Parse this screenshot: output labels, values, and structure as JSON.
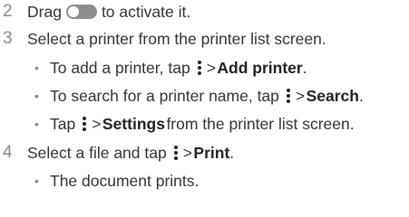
{
  "steps": [
    {
      "number": "2",
      "text_before": "Drag",
      "text_after": "to activate it."
    },
    {
      "number": "3",
      "text": "Select a printer from the printer list screen.",
      "bullets": [
        {
          "bullet": "•",
          "before": "To add a printer, tap",
          "arrow": ">",
          "bold": "Add printer",
          "after": "."
        },
        {
          "bullet": "•",
          "before": "To search for a printer name, tap",
          "arrow": ">",
          "bold": "Search",
          "after": "."
        },
        {
          "bullet": "•",
          "before": "Tap",
          "arrow": ">",
          "bold": "Settings",
          "after": "from the printer list screen."
        }
      ]
    },
    {
      "number": "4",
      "text_before": "Select a file and tap",
      "arrow": ">",
      "bold": "Print",
      "text_after": ".",
      "bullets": [
        {
          "bullet": "•",
          "text": "The document prints."
        }
      ]
    }
  ],
  "icons": {
    "toggle": "toggle-switch-icon",
    "menu": "more-options-icon"
  }
}
